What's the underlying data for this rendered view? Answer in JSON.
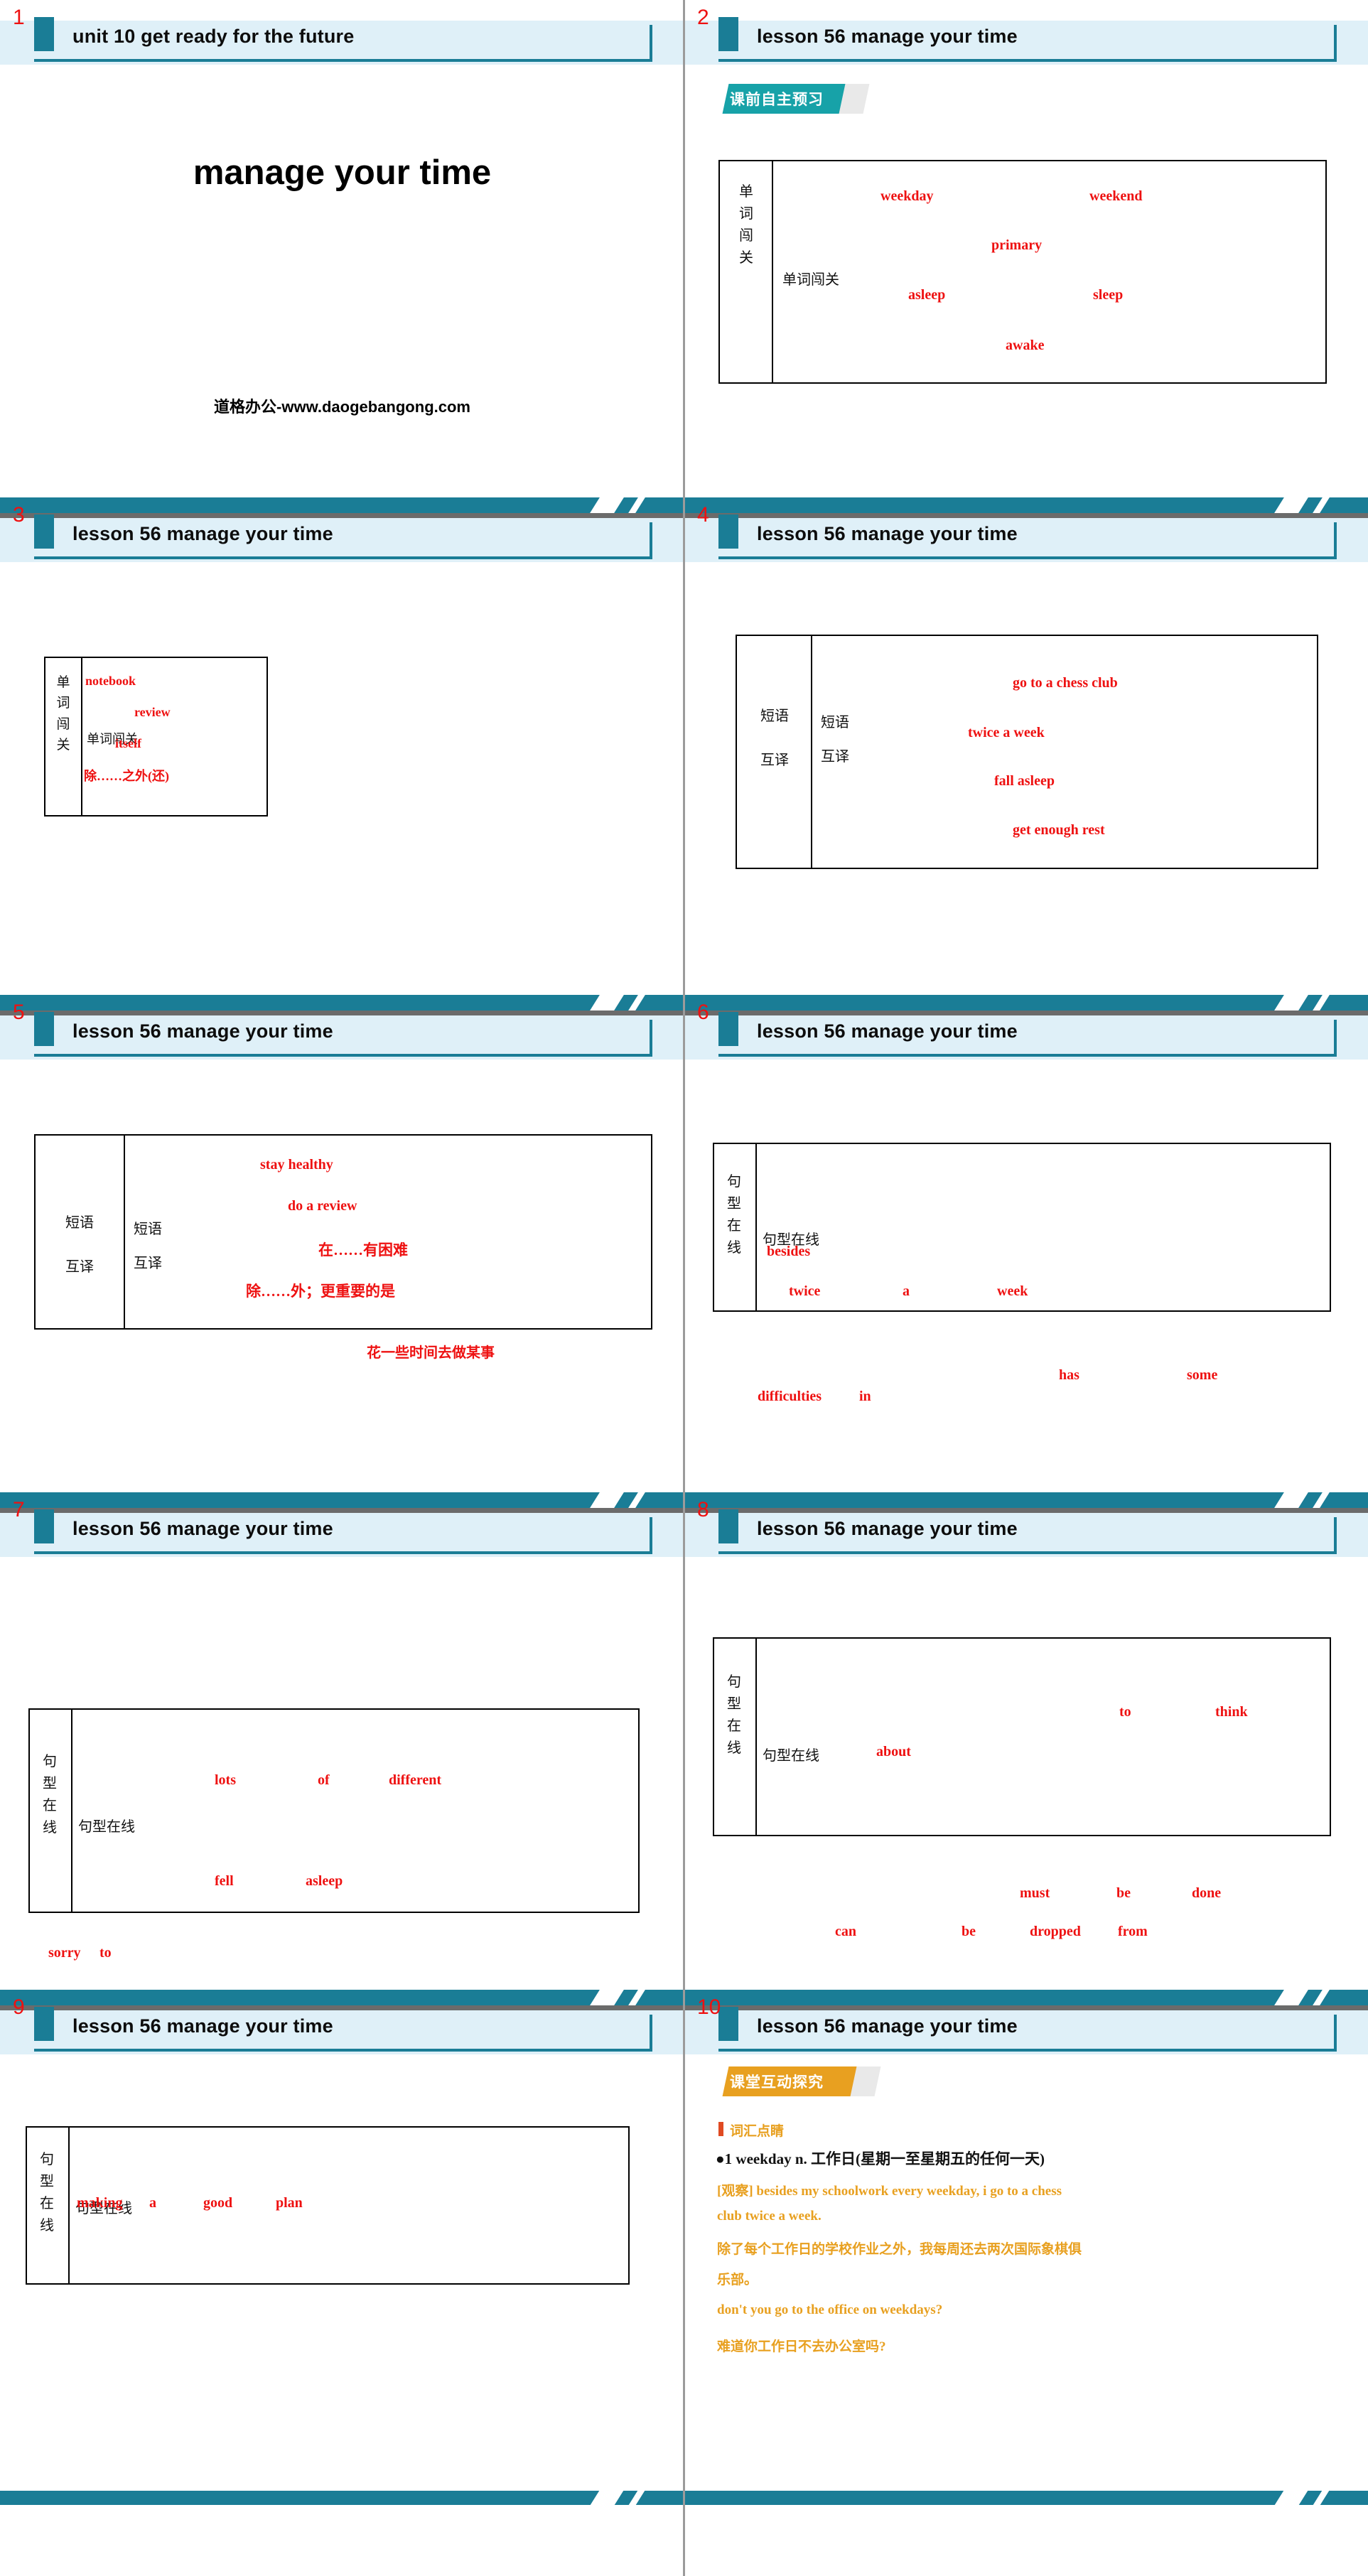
{
  "meta": {
    "watermark": "道格办公-www.daogebangong.com",
    "cover_title": "manage your time",
    "accent_teal": "#1a7d96",
    "accent_red": "#ee1111",
    "accent_orange": "#e8a020",
    "header_band": "#dff0f8"
  },
  "slides": [
    {
      "number": "1",
      "header": "unit 10   get ready for the future",
      "big_title": "manage your time",
      "watermark": "道格办公-www.daogebangong.com"
    },
    {
      "number": "2",
      "header": "lesson 56    manage your time",
      "chip": "课前自主预习",
      "table": {
        "outer_label": "单 词 闯 关",
        "inner_label": "单词闯关",
        "words": [
          "weekday",
          "weekend",
          "primary",
          "asleep",
          "sleep",
          "awake"
        ]
      }
    },
    {
      "number": "3",
      "header": "lesson 56    manage your time",
      "table": {
        "outer_label": "单 词 闯 关",
        "inner_label": "单词闯关",
        "words": [
          "notebook",
          "review",
          "itself",
          "除……之外(还)"
        ]
      }
    },
    {
      "number": "4",
      "header": "lesson 56    manage your time",
      "table": {
        "outer_label": "短语 互译",
        "inner_label": "短语 互译",
        "words": [
          "go to a chess club",
          "twice a week",
          "fall asleep",
          "get enough rest"
        ]
      }
    },
    {
      "number": "5",
      "header": "lesson 56    manage your time",
      "table": {
        "outer_label": "短语 互译",
        "inner_label": "短语 互译",
        "words": [
          "stay healthy",
          "do a review",
          "在……有困难",
          "除……外；更重要的是",
          "花一些时间去做某事"
        ]
      }
    },
    {
      "number": "6",
      "header": "lesson 56    manage your time",
      "table": {
        "outer_label": "句 型 在 线",
        "inner_label": "句型在线",
        "words": [
          "besides",
          "twice",
          "a",
          "week"
        ]
      },
      "below_words": [
        "has",
        "some",
        "difficulties",
        "in"
      ]
    },
    {
      "number": "7",
      "header": "lesson 56    manage your time",
      "table": {
        "outer_label": "句 型 在 线",
        "inner_label": "句型在线",
        "words": [
          "lots",
          "of",
          "different",
          "fell",
          "asleep"
        ]
      },
      "below_words": [
        "sorry",
        "to"
      ]
    },
    {
      "number": "8",
      "header": "lesson 56    manage your time",
      "table": {
        "outer_label": "句 型 在 线",
        "inner_label": "句型在线",
        "words": [
          "to",
          "think",
          "about"
        ]
      },
      "below_words": [
        "must",
        "be",
        "done",
        "can",
        "be",
        "dropped",
        "from"
      ]
    },
    {
      "number": "9",
      "header": "lesson 56    manage your time",
      "table": {
        "outer_label": "句 型 在 线",
        "inner_label": "句型在线",
        "words": [
          "making",
          "a",
          "good",
          "plan"
        ]
      }
    },
    {
      "number": "10",
      "header": "lesson 56    manage your time",
      "chip": "课堂互动探究",
      "section_title": "词汇点睛",
      "entry": "●1  weekday n. 工作日(星期一至星期五的任何一天)",
      "lines": [
        "[观察] besides my schoolwork every weekday, i go to a chess",
        "club twice a week.",
        "除了每个工作日的学校作业之外，我每周还去两次国际象棋俱",
        "乐部。",
        "don't you go to the office on weekdays?",
        "难道你工作日不去办公室吗?"
      ]
    }
  ]
}
